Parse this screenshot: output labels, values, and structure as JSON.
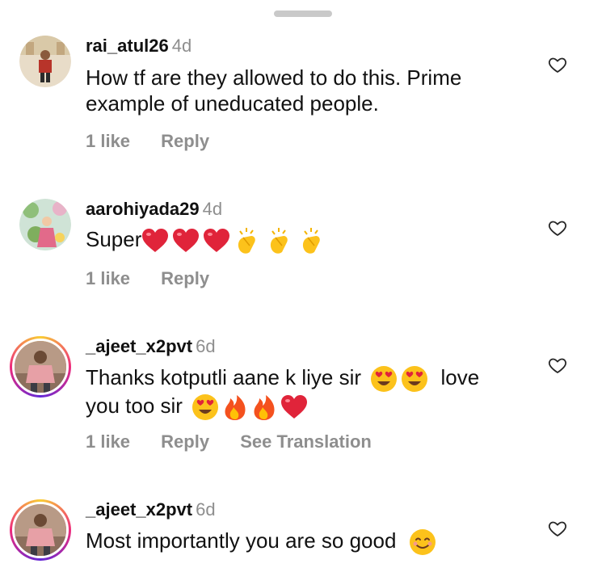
{
  "comments": [
    {
      "username": "rai_atul26",
      "time": "4d",
      "text": "How tf are they allowed to do this. Prime example of uneducated people.",
      "likes": "1 like",
      "reply": "Reply"
    },
    {
      "username": "aarohiyada29",
      "time": "4d",
      "text": "Super",
      "emojis": [
        "red-heart",
        "red-heart",
        "red-heart",
        "clapping-hands",
        "clapping-hands",
        "clapping-hands"
      ],
      "likes": "1 like",
      "reply": "Reply"
    },
    {
      "username": "_ajeet_x2pvt",
      "time": "6d",
      "text_part1": "Thanks kotputli aane k liye sir",
      "text_part2": "love",
      "text_part3": "you too sir",
      "emojis": [
        "heart-eyes",
        "heart-eyes",
        "heart-eyes",
        "fire",
        "fire",
        "red-heart"
      ],
      "likes": "1 like",
      "reply": "Reply",
      "translate": "See Translation"
    },
    {
      "username": "_ajeet_x2pvt",
      "time": "6d",
      "text": "Most importantly you are so good",
      "emojis": [
        "smiling-face"
      ]
    }
  ],
  "colors": {
    "secondary_text": "#8e8e8e",
    "primary_text": "#111111"
  }
}
